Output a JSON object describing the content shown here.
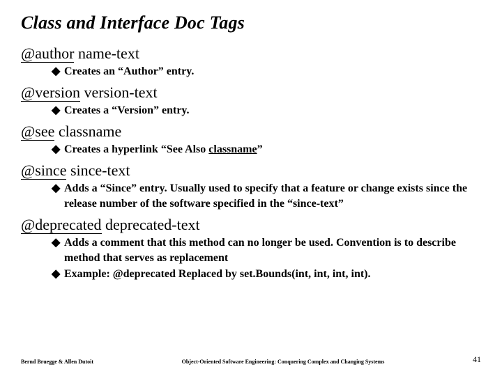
{
  "title": "Class and Interface Doc Tags",
  "tags": {
    "author": {
      "at": "@author",
      "rest": " name-text",
      "item": "Creates an “Author” entry."
    },
    "version": {
      "at": "@version",
      "rest": " version-text",
      "item": "Creates a “Version” entry."
    },
    "see": {
      "at": "@see",
      "rest": " classname",
      "prefix": "Creates a hyperlink “See Also ",
      "ul": "classname",
      "suffix": "”"
    },
    "since": {
      "at": "@since",
      "rest": " since-text",
      "item": "Adds a “Since” entry. Usually  used to specify that a feature or change exists since the release number of the software specified in the “since-text”"
    },
    "deprecated": {
      "at": "@deprecated",
      "rest": " deprecated-text",
      "item1": "Adds a comment that this method can no longer be used. Convention is to describe method that serves as replacement",
      "item2": "Example: @deprecated  Replaced by set.Bounds(int, int, int, int)."
    }
  },
  "bullet": "◆",
  "footer": {
    "left": "Bernd Bruegge & Allen Dutoit",
    "center": "Object-Oriented Software Engineering: Conquering Complex and Changing Systems",
    "right": "41"
  }
}
